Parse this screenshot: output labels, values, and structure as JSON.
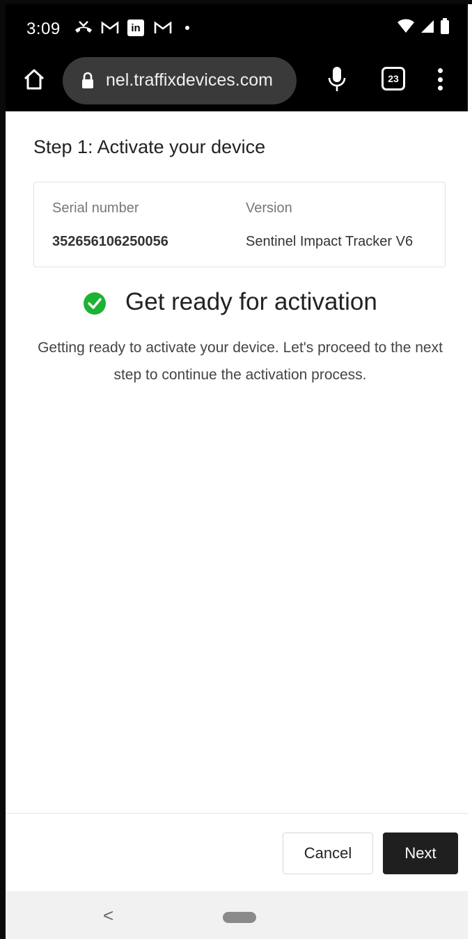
{
  "status_bar": {
    "time": "3:09",
    "icons": [
      "missed-call-icon",
      "gmail-icon",
      "linkedin-icon",
      "gmail-icon",
      "dot-icon",
      "wifi-icon",
      "signal-icon",
      "battery-icon"
    ],
    "linkedin_text": "in"
  },
  "browser": {
    "url": "nel.traffixdevices.com",
    "tab_count": "23"
  },
  "page": {
    "step_title": "Step 1: Activate your device",
    "serial_label": "Serial number",
    "serial_value": "352656106250056",
    "version_label": "Version",
    "version_value": "Sentinel Impact Tracker V6",
    "ready_title": "Get ready for activation",
    "ready_desc": "Getting ready to activate your device. Let's proceed to the next step to continue the activation process."
  },
  "footer": {
    "cancel_label": "Cancel",
    "next_label": "Next"
  },
  "nav": {
    "back_glyph": "<"
  },
  "colors": {
    "success": "#1db233",
    "primary_button": "#1f1f1f"
  }
}
